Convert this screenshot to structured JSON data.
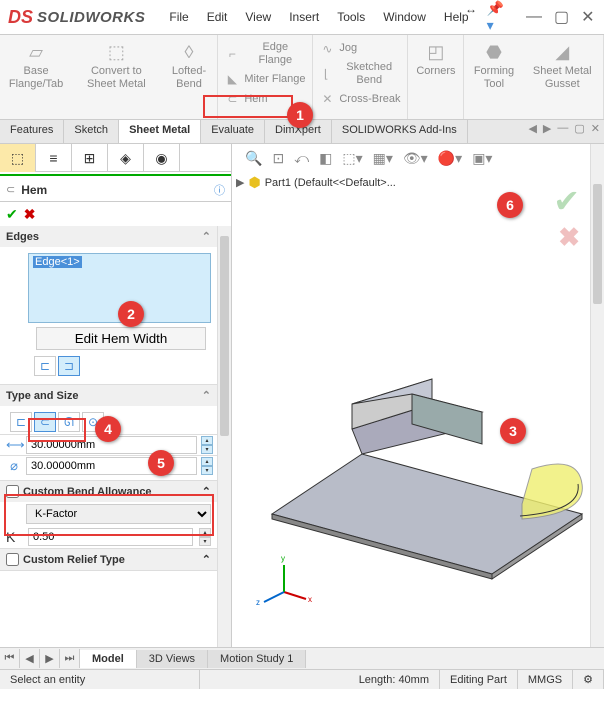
{
  "app": {
    "name": "SOLIDWORKS",
    "logo_prefix": "DS"
  },
  "menu": [
    "File",
    "Edit",
    "View",
    "Insert",
    "Tools",
    "Window",
    "Help"
  ],
  "ribbon": {
    "base": "Base Flange/Tab",
    "convert": "Convert to Sheet Metal",
    "lofted": "Lofted-Bend",
    "edge_flange": "Edge Flange",
    "miter": "Miter Flange",
    "hem": "Hem",
    "jog": "Jog",
    "sketched": "Sketched Bend",
    "cross": "Cross-Break",
    "corners": "Corners",
    "forming": "Forming Tool",
    "gusset": "Sheet Metal Gusset"
  },
  "tabs": [
    "Features",
    "Sketch",
    "Sheet Metal",
    "Evaluate",
    "DimXpert",
    "SOLIDWORKS Add-Ins"
  ],
  "active_tab": "Sheet Metal",
  "feature": {
    "title": "Hem",
    "edges_label": "Edges",
    "edge1": "Edge<1>",
    "edit_width": "Edit Hem Width",
    "type_size": "Type and Size",
    "length_val": "30.00000mm",
    "diameter_val": "30.00000mm",
    "cba": "Custom Bend Allowance",
    "kfactor_label": "K-Factor",
    "kfactor_val": "0.50",
    "crt": "Custom Relief Type"
  },
  "tree": {
    "part": "Part1 (Default<<Default>..."
  },
  "bottom_tabs": [
    "Model",
    "3D Views",
    "Motion Study 1"
  ],
  "status": {
    "prompt": "Select an entity",
    "length": "Length: 40mm",
    "mode": "Editing Part",
    "units": "MMGS"
  },
  "markers": {
    "1": "1",
    "2": "2",
    "3": "3",
    "4": "4",
    "5": "5",
    "6": "6"
  }
}
